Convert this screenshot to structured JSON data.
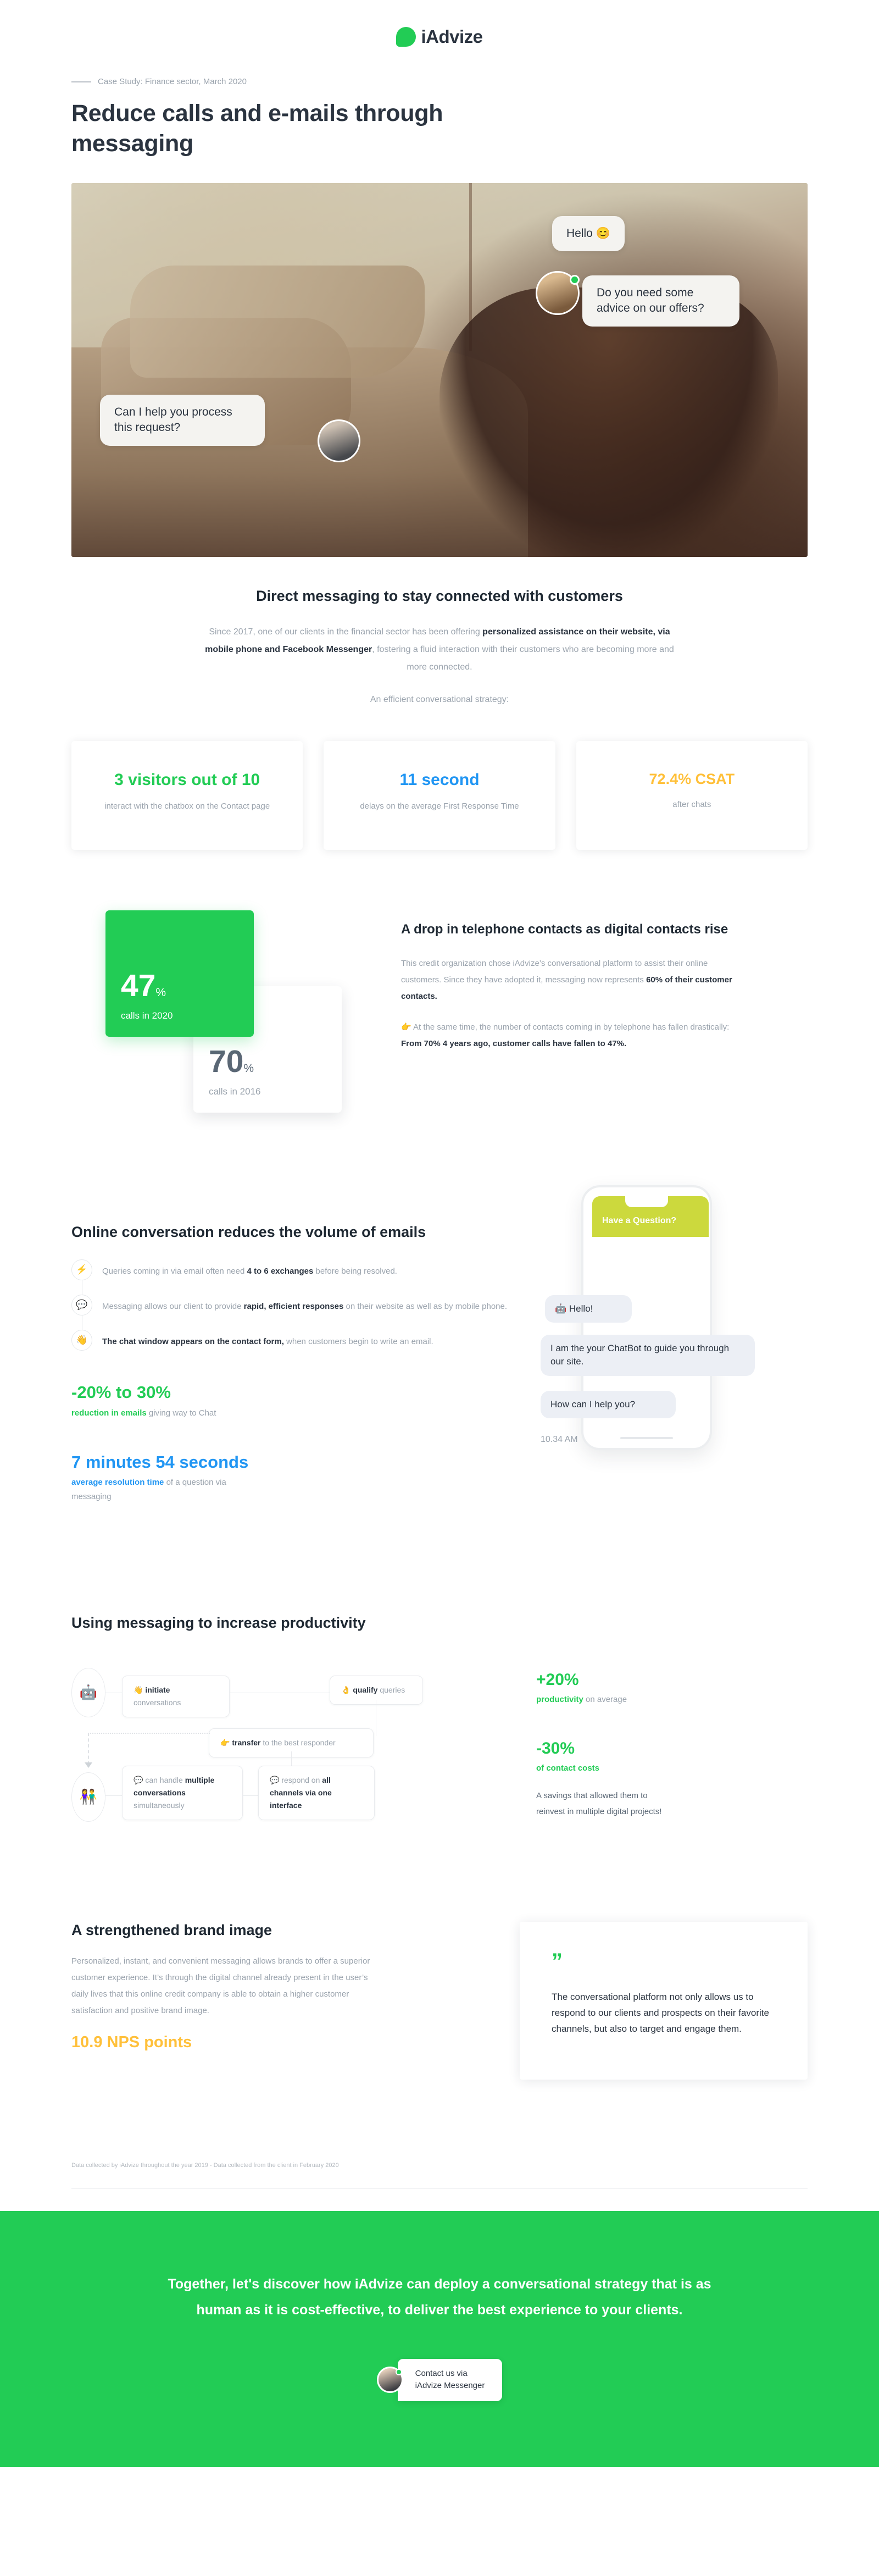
{
  "brand": {
    "name": "iAdvize",
    "green": "#22CC55",
    "blue": "#2196F3",
    "amber": "#FFC03A",
    "logo_icon": "speech-bubble-icon"
  },
  "header": {
    "kicker": "Case Study: Finance sector, March 2020",
    "title": "Reduce calls and e-mails through messaging"
  },
  "hero": {
    "bubbles": [
      {
        "id": "hello",
        "text": "Hello 😊"
      },
      {
        "id": "advice",
        "text": "Do you need some advice on our offers?"
      },
      {
        "id": "process",
        "text": "Can I help you process this request?"
      }
    ]
  },
  "intro": {
    "heading": "Direct messaging to stay connected with customers",
    "paragraph_1": "Since 2017, one of our clients in the financial sector has been offering ",
    "paragraph_bold_1": "personalized assistance on their website, via mobile phone and Facebook Messenger",
    "paragraph_2": ", fostering a fluid interaction with their customers who are becoming more and more connected.",
    "strategy_line": "An efficient conversational strategy:"
  },
  "stat_cards": [
    {
      "value_a": "3",
      "value_mid": " visitors out of ",
      "value_b": "10",
      "color": "#22CC55",
      "sub": "interact with the chatbox on the Contact page"
    },
    {
      "value_a": "11",
      "value_mid": " second",
      "value_b": "",
      "color": "#2196F3",
      "sub": "delays on the average First Response Time"
    },
    {
      "value_a": "72.4%",
      "value_mid": " CSAT",
      "value_b": "",
      "color": "#FFC03A",
      "sub": "after chats"
    }
  ],
  "drop_section": {
    "kpi_green": {
      "number": "47",
      "pct": "%",
      "label": "calls in 2020"
    },
    "kpi_white": {
      "number": "70",
      "pct": "%",
      "label": "calls in 2016"
    },
    "heading": "A drop in telephone contacts as digital contacts rise",
    "para_1_a": "This credit organization chose iAdvize’s conversational platform to assist their online customers. Since they have adopted it, messaging now represents ",
    "para_1_bold": "60% of their customer contacts.",
    "para_2_emoji": "👉",
    "para_2_a": " At the same time, the number of contacts coming in by telephone has fallen drastically: ",
    "para_2_bold": "From 70% 4 years ago, customer calls have fallen to 47%."
  },
  "emails_section": {
    "heading": "Online conversation reduces the volume of emails",
    "bullets": [
      {
        "icon": "lightning-bolt-icon",
        "emoji": "⚡",
        "text_a": "Queries coming in via email often need ",
        "bold": "4 to 6 exchanges",
        "text_b": " before being resolved."
      },
      {
        "icon": "chat-bubble-icon",
        "emoji": "💬",
        "text_a": "Messaging allows our client to provide ",
        "bold": "rapid, efficient responses",
        "text_b": " on their website as well as by mobile phone."
      },
      {
        "icon": "waving-hand-icon",
        "emoji": "👋",
        "text_a": "",
        "bold": "The chat window appears on the contact form,",
        "text_b": " when customers begin to write an email."
      }
    ],
    "stat_1": {
      "number": "-20% to 30%",
      "color": "#22CC55",
      "sub_bold": "reduction in emails",
      "sub_rest": " giving way to Chat"
    },
    "stat_2": {
      "number": "7 minutes 54 seconds",
      "color": "#2196F3",
      "sub_bold": "average resolution time",
      "sub_rest": " of a question via messaging"
    },
    "phone": {
      "header": "Have a Question?",
      "messages": [
        {
          "emoji": "🤖",
          "text": "Hello!"
        },
        {
          "emoji": "",
          "text": "I am the your ChatBot to guide you through our site."
        },
        {
          "emoji": "",
          "text": "How can I help you?"
        }
      ],
      "timestamp": "10.34 AM"
    }
  },
  "productivity": {
    "heading": "Using messaging to increase productivity",
    "nodes": [
      {
        "id": "bot",
        "icon": "robot-icon",
        "emoji": "🤖"
      },
      {
        "id": "initiate",
        "emoji": "👋",
        "bold": "initiate",
        "rest": " conversations"
      },
      {
        "id": "qualify",
        "emoji": "👌",
        "bold": "qualify",
        "rest": " queries"
      },
      {
        "id": "transfer",
        "emoji": "👉",
        "bold": "transfer",
        "rest": " to the best responder"
      },
      {
        "id": "humans",
        "icon": "people-icon",
        "emoji": "👫"
      },
      {
        "id": "multiple",
        "emoji": "💬",
        "pre": "can handle ",
        "bold": "multiple conversations",
        "rest": " simultaneously"
      },
      {
        "id": "channels",
        "emoji": "💬",
        "pre": "respond on ",
        "bold": "all channels via one interface",
        "rest": ""
      }
    ],
    "stat_1": {
      "number": "+20%",
      "sub_bold": "productivity",
      "sub_rest": " on average"
    },
    "stat_2": {
      "number": "-30%",
      "sub_bold": "of contact costs",
      "sub_rest": ""
    },
    "note": "A savings that allowed them to reinvest in multiple digital projects!"
  },
  "brand_section": {
    "heading": "A strengthened brand image",
    "paragraph": "Personalized, instant, and convenient messaging allows brands to offer a superior customer experience. It’s through the digital channel already present in the user’s daily lives that this online credit company is able to obtain a higher customer satisfaction and positive brand image.",
    "nps_number": "10.9",
    "nps_label": " NPS points",
    "quote_mark": "”",
    "quote": "The conversational platform not only allows us to respond to our clients and prospects on their favorite channels, but also to target and engage them."
  },
  "footer": {
    "footnote": "Data collected by iAdvize throughout the year 2019 - Data collected  from the client in February 2020",
    "cta_heading": "Together, let's discover how iAdvize can deploy a conversational strategy that is as human as it is cost-effective, to deliver the best experience to your clients.",
    "cta_button_line_1": "Contact us via",
    "cta_button_line_2": "iAdvize Messenger"
  }
}
